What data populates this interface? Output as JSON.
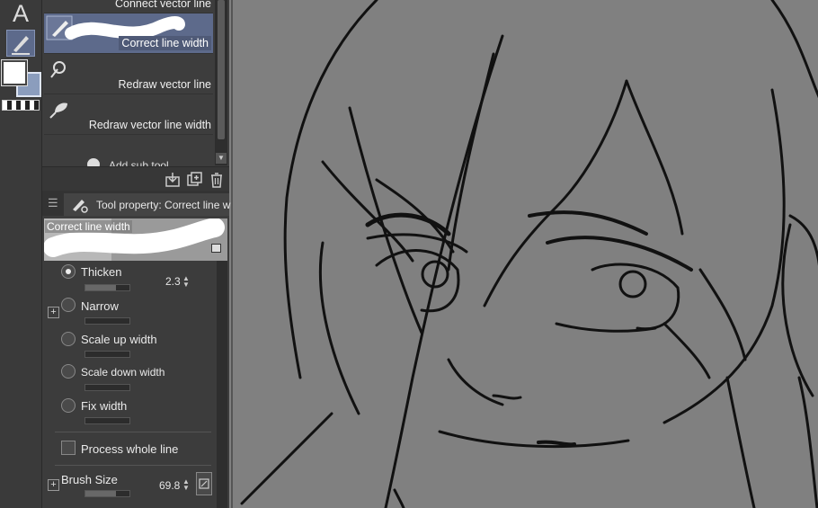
{
  "toolbar": {
    "text_tool_glyph": "A",
    "colors": {
      "main": "#ffffff",
      "sub": "#8b9dbd",
      "transparent_bar": "checker"
    }
  },
  "subtool": {
    "items": [
      {
        "label": "Connect vector line",
        "icon": "connect-line-icon",
        "selected": false
      },
      {
        "label": "Correct line width",
        "icon": "correct-width-icon",
        "selected": true
      },
      {
        "label": "Redraw vector line",
        "icon": "redraw-line-icon",
        "selected": false
      },
      {
        "label": "Redraw vector line width",
        "icon": "redraw-width-icon",
        "selected": false
      }
    ],
    "add_sub_tool": "Add sub tool",
    "footer_icons": [
      "import-icon",
      "duplicate-icon",
      "delete-icon"
    ]
  },
  "tool_property": {
    "header": "Tool property: Correct line w",
    "preview_label": "Correct line width",
    "options": [
      {
        "label": "Thicken",
        "selected": true,
        "value": "2.3",
        "fill": 0.7
      },
      {
        "label": "Narrow",
        "selected": false,
        "fill": 0
      },
      {
        "label": "Scale up width",
        "selected": false,
        "fill": 0
      },
      {
        "label": "Scale down width",
        "selected": false,
        "fill": 0
      },
      {
        "label": "Fix width",
        "selected": false,
        "fill": 0
      }
    ],
    "process_whole_line": {
      "label": "Process whole line",
      "checked": false
    },
    "brush_size": {
      "label": "Brush Size",
      "value": "69.8",
      "fill": 0.7
    }
  },
  "colors": {
    "panel": "#3c3c3c",
    "selection": "#5d6a8b",
    "canvas": "#808080"
  }
}
